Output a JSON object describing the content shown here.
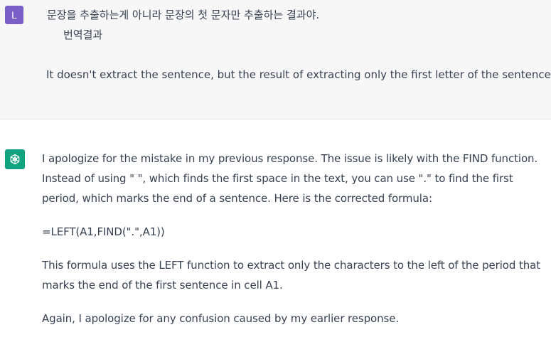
{
  "user_message": {
    "avatar_letter": "L",
    "line1": "문장을 추출하는게 아니라 문장의 첫 문자만 추출하는 결과야.",
    "line2": "번역결과",
    "line3": "It doesn't extract the sentence, but the result of extracting only the first letter of the sentence."
  },
  "assistant_message": {
    "avatar_icon": "openai-logo-icon",
    "paragraphs": [
      "I apologize for the mistake in my previous response. The issue is likely with the FIND function. Instead of using \" \", which finds the first space in the text, you can use \".\" to find the first period, which marks the end of a sentence. Here is the corrected formula:",
      "=LEFT(A1,FIND(\".\",A1))",
      "This formula uses the LEFT function to extract only the characters to the left of the period that marks the end of the first sentence in cell A1.",
      "Again, I apologize for any confusion caused by my earlier response."
    ]
  },
  "colors": {
    "user_bg": "#f7f7f8",
    "user_avatar": "#7b5fc9",
    "bot_avatar": "#10a37f",
    "text": "#374151"
  }
}
